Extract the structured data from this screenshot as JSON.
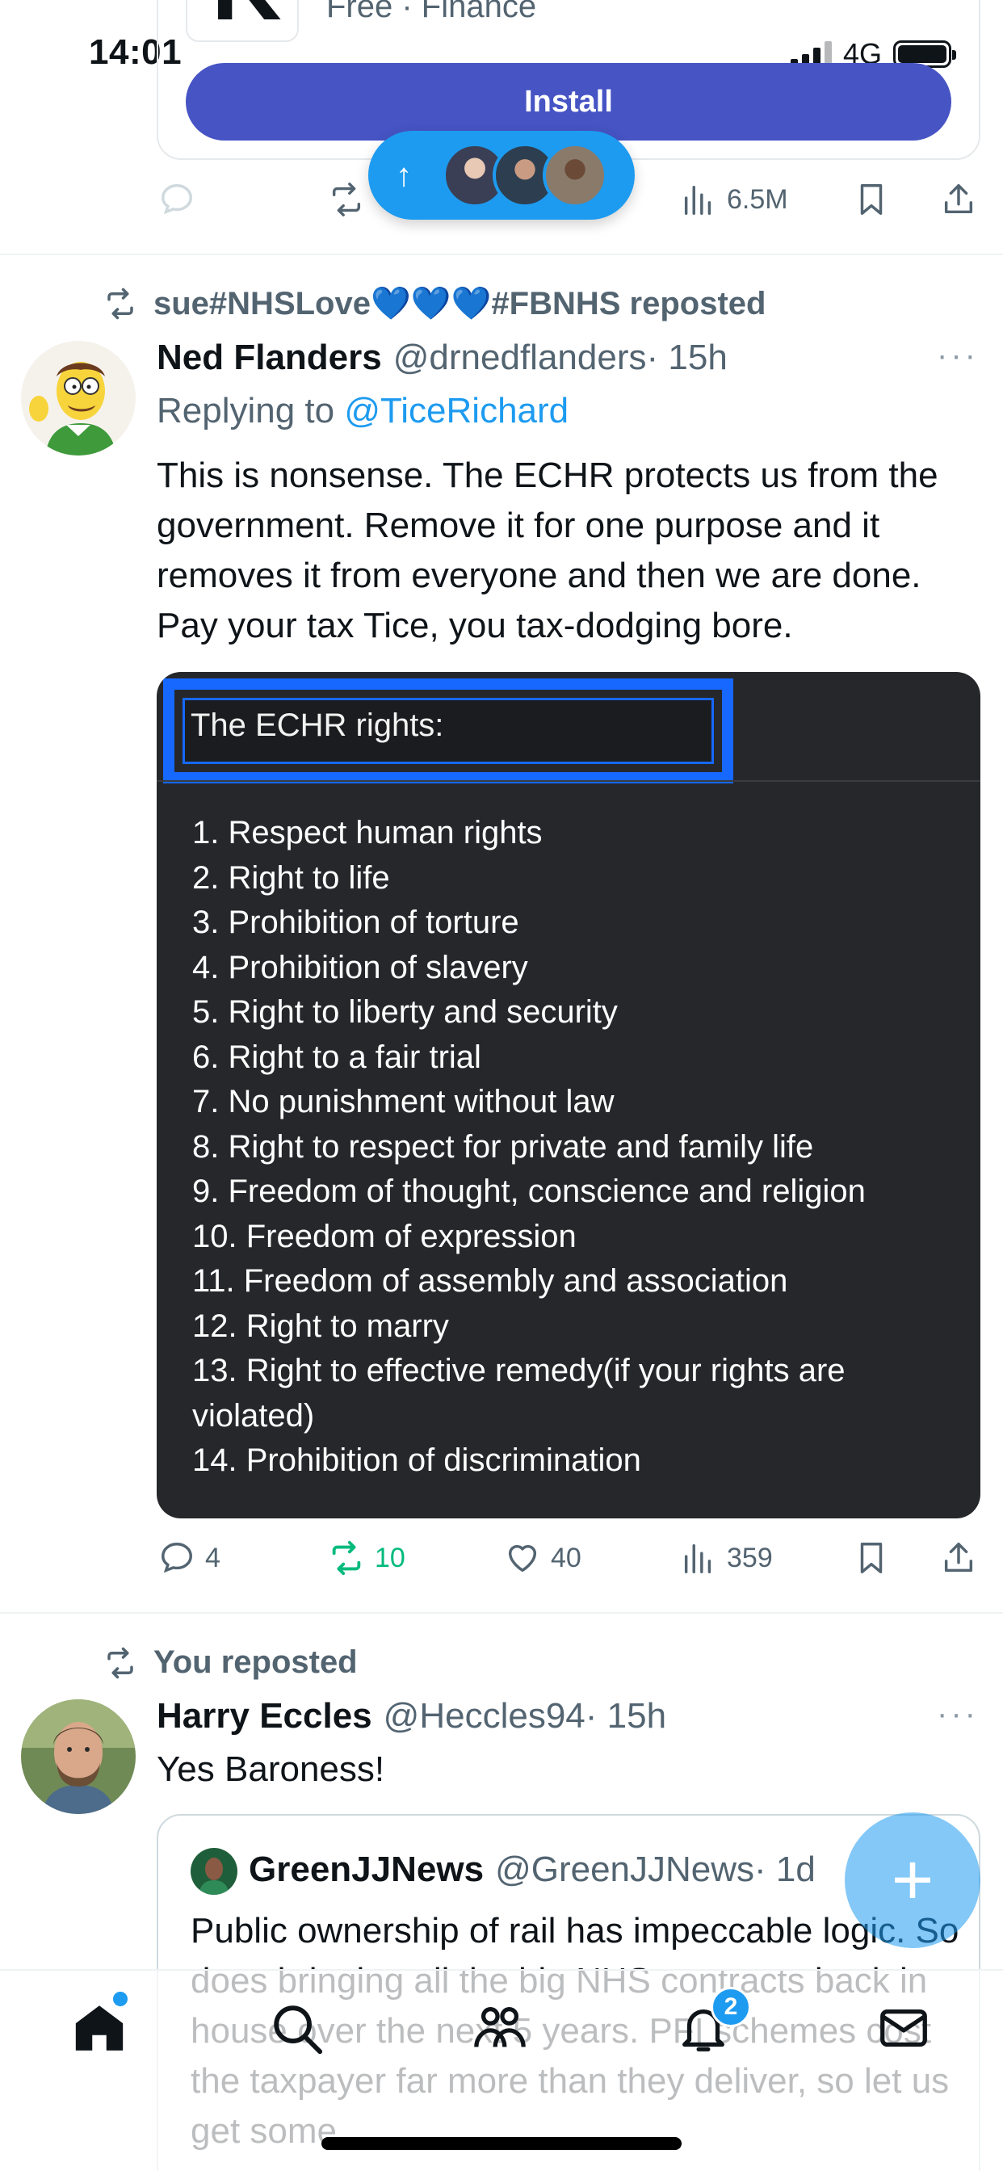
{
  "status_bar": {
    "time": "14:01",
    "network": "4G"
  },
  "ad": {
    "logo_letter": "K",
    "meta": "Free · Finance",
    "install_label": "Install"
  },
  "top_actions": {
    "views": "6.5M"
  },
  "new_posts_pill": {
    "arrow": "↑"
  },
  "post1": {
    "repost_by": "sue#NHSLove💙💙💙#FBNHS reposted",
    "name": "Ned Flanders",
    "handle": "@drnedflanders",
    "time": "· 15h",
    "more": "···",
    "replying_prefix": "Replying to ",
    "replying_to": "@TiceRichard",
    "text": "This is nonsense. The ECHR protects us from the government. Remove it for one purpose and it removes it from everyone and then we are done. Pay your tax Tice, you tax-dodging bore.",
    "image": {
      "title": "The ECHR rights:",
      "rights": [
        "1. Respect human rights",
        "2. Right to life",
        "3. Prohibition of torture",
        "4. Prohibition of slavery",
        "5. Right to liberty and security",
        "6. Right to a fair trial",
        "7. No punishment without law",
        "8. Right to respect for private and family life",
        "9. Freedom of thought, conscience and religion",
        "10. Freedom of expression",
        "11. Freedom of assembly and association",
        "12. Right to marry",
        "13. Right to effective remedy(if your rights are violated)",
        "14. Prohibition of discrimination"
      ]
    },
    "replies": "4",
    "reposts": "10",
    "likes": "40",
    "views": "359"
  },
  "post2": {
    "repost_by": "You reposted",
    "name": "Harry Eccles",
    "handle": "@Heccles94",
    "time": "· 15h",
    "more": "···",
    "text": "Yes Baroness!",
    "quote": {
      "name": "GreenJJNews",
      "handle": "@GreenJJNews",
      "time": "· 1d",
      "text": "Public ownership of rail has impeccable logic. So does bringing all the big NHS contracts back in house over the next 5 years. PFI schemes cost the taxpayer far more than they deliver, so let us get some"
    }
  },
  "fab_label": "+",
  "bottom_nav": {
    "notifications_badge": "2"
  },
  "colors": {
    "accent": "#1d9bf0",
    "repost_green": "#00ba7c",
    "install": "#4654c4",
    "highlight_box": "#1668ff"
  }
}
